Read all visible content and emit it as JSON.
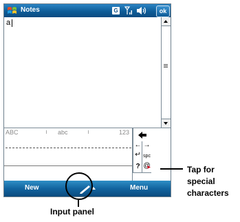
{
  "window": {
    "title": "Notes",
    "ok_label": "ok",
    "status_badge": "G"
  },
  "note": {
    "content": "a"
  },
  "keyboard": {
    "abc_upper": "ABC",
    "abc_lower": "abc",
    "numbers": "123",
    "space_key": "spc",
    "question_key": "?",
    "at_key": "@"
  },
  "menubar": {
    "left_softkey": "New",
    "right_softkey": "Menu"
  },
  "annotations": {
    "input_panel": "Input panel",
    "special_chars_line1": "Tap for special",
    "special_chars_line2": "characters"
  },
  "colors": {
    "titlebar": "#0e5c98",
    "menubar": "#12649f"
  }
}
